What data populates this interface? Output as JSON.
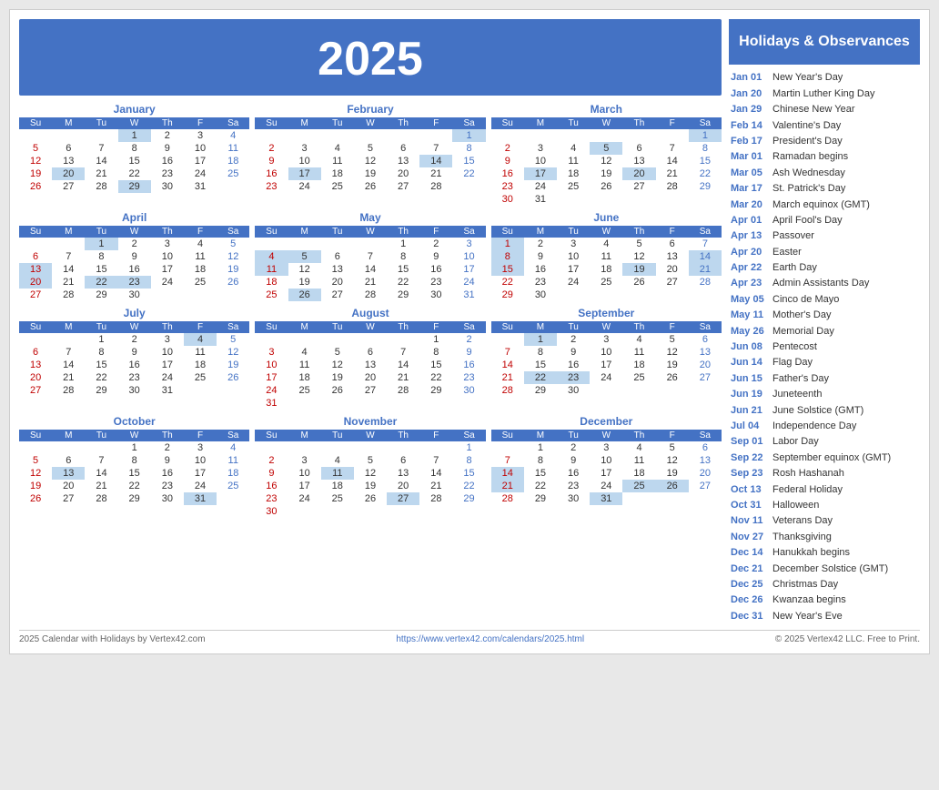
{
  "year": "2025",
  "title": "2025",
  "sidebar": {
    "header": "Holidays &\nObservances",
    "holidays": [
      {
        "date": "Jan 01",
        "name": "New Year's Day"
      },
      {
        "date": "Jan 20",
        "name": "Martin Luther King Day"
      },
      {
        "date": "Jan 29",
        "name": "Chinese New Year"
      },
      {
        "date": "Feb 14",
        "name": "Valentine's Day"
      },
      {
        "date": "Feb 17",
        "name": "President's Day"
      },
      {
        "date": "Mar 01",
        "name": "Ramadan begins"
      },
      {
        "date": "Mar 05",
        "name": "Ash Wednesday"
      },
      {
        "date": "Mar 17",
        "name": "St. Patrick's Day"
      },
      {
        "date": "Mar 20",
        "name": "March equinox (GMT)"
      },
      {
        "date": "Apr 01",
        "name": "April Fool's Day"
      },
      {
        "date": "Apr 13",
        "name": "Passover"
      },
      {
        "date": "Apr 20",
        "name": "Easter"
      },
      {
        "date": "Apr 22",
        "name": "Earth Day"
      },
      {
        "date": "Apr 23",
        "name": "Admin Assistants Day"
      },
      {
        "date": "May 05",
        "name": "Cinco de Mayo"
      },
      {
        "date": "May 11",
        "name": "Mother's Day"
      },
      {
        "date": "May 26",
        "name": "Memorial Day"
      },
      {
        "date": "Jun 08",
        "name": "Pentecost"
      },
      {
        "date": "Jun 14",
        "name": "Flag Day"
      },
      {
        "date": "Jun 15",
        "name": "Father's Day"
      },
      {
        "date": "Jun 19",
        "name": "Juneteenth"
      },
      {
        "date": "Jun 21",
        "name": "June Solstice (GMT)"
      },
      {
        "date": "Jul 04",
        "name": "Independence Day"
      },
      {
        "date": "Sep 01",
        "name": "Labor Day"
      },
      {
        "date": "Sep 22",
        "name": "September equinox (GMT)"
      },
      {
        "date": "Sep 23",
        "name": "Rosh Hashanah"
      },
      {
        "date": "Oct 13",
        "name": "Federal Holiday"
      },
      {
        "date": "Oct 31",
        "name": "Halloween"
      },
      {
        "date": "Nov 11",
        "name": "Veterans Day"
      },
      {
        "date": "Nov 27",
        "name": "Thanksgiving"
      },
      {
        "date": "Dec 14",
        "name": "Hanukkah begins"
      },
      {
        "date": "Dec 21",
        "name": "December Solstice (GMT)"
      },
      {
        "date": "Dec 25",
        "name": "Christmas Day"
      },
      {
        "date": "Dec 26",
        "name": "Kwanzaa begins"
      },
      {
        "date": "Dec 31",
        "name": "New Year's Eve"
      }
    ]
  },
  "footer": {
    "left": "2025 Calendar with Holidays by Vertex42.com",
    "center": "https://www.vertex42.com/calendars/2025.html",
    "right": "© 2025 Vertex42 LLC. Free to Print."
  },
  "months": [
    {
      "name": "January",
      "weeks": [
        [
          null,
          null,
          null,
          "1h",
          "2",
          "3",
          "4s"
        ],
        [
          "5",
          "6",
          "7",
          "8",
          "9",
          "10",
          "11s"
        ],
        [
          "12",
          "13",
          "14",
          "15",
          "16",
          "17",
          "18s"
        ],
        [
          "19",
          "20h",
          "21",
          "22",
          "23",
          "24",
          "25s"
        ],
        [
          "26",
          "27",
          "28",
          "29h",
          "30",
          "31",
          null
        ]
      ]
    },
    {
      "name": "February",
      "weeks": [
        [
          null,
          null,
          null,
          null,
          null,
          null,
          "1hs"
        ],
        [
          "2",
          "3",
          "4",
          "5",
          "6",
          "7",
          "8s"
        ],
        [
          "9",
          "10",
          "11",
          "12",
          "13",
          "14h",
          "15s"
        ],
        [
          "16",
          "17h",
          "18",
          "19",
          "20",
          "21",
          "22s"
        ],
        [
          "23",
          "24",
          "25",
          "26",
          "27",
          "28",
          null
        ]
      ]
    },
    {
      "name": "March",
      "weeks": [
        [
          null,
          null,
          null,
          null,
          null,
          null,
          "1hs"
        ],
        [
          "2",
          "3",
          "4",
          "5h",
          "6",
          "7",
          "8s"
        ],
        [
          "9",
          "10",
          "11",
          "12",
          "13",
          "14",
          "15s"
        ],
        [
          "16",
          "17h",
          "18",
          "19",
          "20h",
          "21",
          "22s"
        ],
        [
          "23",
          "24",
          "25",
          "26",
          "27",
          "28",
          "29s"
        ],
        [
          "30",
          "31",
          null,
          null,
          null,
          null,
          null
        ]
      ]
    },
    {
      "name": "April",
      "weeks": [
        [
          null,
          null,
          "1h",
          "2",
          "3",
          "4",
          "5s"
        ],
        [
          "6",
          "7",
          "8",
          "9",
          "10",
          "11",
          "12s"
        ],
        [
          "13h",
          "14",
          "15",
          "16",
          "17",
          "18",
          "19s"
        ],
        [
          "20h",
          "21",
          "22h",
          "23h",
          "24",
          "25",
          "26s"
        ],
        [
          "27",
          "28",
          "29",
          "30",
          null,
          null,
          null
        ]
      ]
    },
    {
      "name": "May",
      "weeks": [
        [
          null,
          null,
          null,
          null,
          "1",
          "2",
          "3s"
        ],
        [
          "4h",
          "5h",
          "6",
          "7",
          "8",
          "9",
          "10s"
        ],
        [
          "11h",
          "12",
          "13",
          "14",
          "15",
          "16",
          "17s"
        ],
        [
          "18",
          "19",
          "20",
          "21",
          "22",
          "23",
          "24s"
        ],
        [
          "25",
          "26h",
          "27",
          "28",
          "29",
          "30",
          "31s"
        ]
      ]
    },
    {
      "name": "June",
      "weeks": [
        [
          "1h",
          "2",
          "3",
          "4",
          "5",
          "6",
          "7s"
        ],
        [
          "8h",
          "9",
          "10",
          "11",
          "12",
          "13",
          "14hs"
        ],
        [
          "15h",
          "16",
          "17",
          "18",
          "19h",
          "20",
          "21hs"
        ],
        [
          "22",
          "23",
          "24",
          "25",
          "26",
          "27",
          "28s"
        ],
        [
          "29",
          "30",
          null,
          null,
          null,
          null,
          null
        ]
      ]
    },
    {
      "name": "July",
      "weeks": [
        [
          null,
          null,
          "1",
          "2",
          "3",
          "4h",
          "5s"
        ],
        [
          "6",
          "7",
          "8",
          "9",
          "10",
          "11",
          "12s"
        ],
        [
          "13",
          "14",
          "15",
          "16",
          "17",
          "18",
          "19s"
        ],
        [
          "20",
          "21",
          "22",
          "23",
          "24",
          "25",
          "26s"
        ],
        [
          "27",
          "28",
          "29",
          "30",
          "31",
          null,
          null
        ]
      ]
    },
    {
      "name": "August",
      "weeks": [
        [
          null,
          null,
          null,
          null,
          null,
          "1",
          "2s"
        ],
        [
          "3",
          "4",
          "5",
          "6",
          "7",
          "8",
          "9s"
        ],
        [
          "10",
          "11",
          "12",
          "13",
          "14",
          "15",
          "16s"
        ],
        [
          "17",
          "18",
          "19",
          "20",
          "21",
          "22",
          "23s"
        ],
        [
          "24",
          "25",
          "26",
          "27",
          "28",
          "29",
          "30s"
        ],
        [
          "31",
          null,
          null,
          null,
          null,
          null,
          null
        ]
      ]
    },
    {
      "name": "September",
      "weeks": [
        [
          null,
          "1h",
          "2",
          "3",
          "4",
          "5",
          "6s"
        ],
        [
          "7",
          "8",
          "9",
          "10",
          "11",
          "12",
          "13s"
        ],
        [
          "14",
          "15",
          "16",
          "17",
          "18",
          "19",
          "20s"
        ],
        [
          "21",
          "22h",
          "23h",
          "24",
          "25",
          "26",
          "27s"
        ],
        [
          "28",
          "29",
          "30",
          null,
          null,
          null,
          null
        ]
      ]
    },
    {
      "name": "October",
      "weeks": [
        [
          null,
          null,
          null,
          "1",
          "2",
          "3",
          "4s"
        ],
        [
          "5",
          "6",
          "7",
          "8",
          "9",
          "10",
          "11s"
        ],
        [
          "12",
          "13h",
          "14",
          "15",
          "16",
          "17",
          "18s"
        ],
        [
          "19",
          "20",
          "21",
          "22",
          "23",
          "24",
          "25s"
        ],
        [
          "26",
          "27",
          "28",
          "29",
          "30",
          "31h",
          null
        ]
      ]
    },
    {
      "name": "November",
      "weeks": [
        [
          null,
          null,
          null,
          null,
          null,
          null,
          "1s"
        ],
        [
          "2",
          "3",
          "4",
          "5",
          "6",
          "7",
          "8s"
        ],
        [
          "9",
          "10",
          "11h",
          "12",
          "13",
          "14",
          "15s"
        ],
        [
          "16",
          "17",
          "18",
          "19",
          "20",
          "21",
          "22s"
        ],
        [
          "23",
          "24",
          "25",
          "26",
          "27h",
          "28",
          "29s"
        ],
        [
          "30",
          null,
          null,
          null,
          null,
          null,
          null
        ]
      ]
    },
    {
      "name": "December",
      "weeks": [
        [
          null,
          "1",
          "2",
          "3",
          "4",
          "5",
          "6s"
        ],
        [
          "7",
          "8",
          "9",
          "10",
          "11",
          "12",
          "13s"
        ],
        [
          "14h",
          "15",
          "16",
          "17",
          "18",
          "19",
          "20s"
        ],
        [
          "21h",
          "22",
          "23",
          "24",
          "25h",
          "26h",
          "27s"
        ],
        [
          "28",
          "29",
          "30",
          "31h",
          null,
          null,
          null
        ]
      ]
    }
  ]
}
